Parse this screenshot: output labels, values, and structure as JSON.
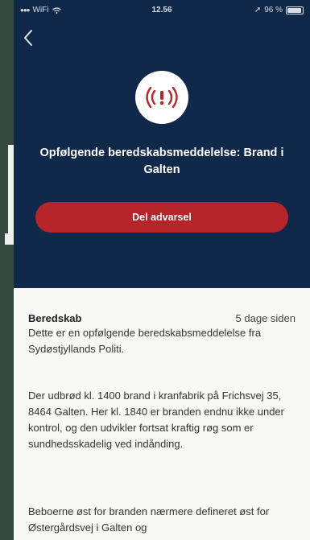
{
  "status_bar": {
    "carrier": "WiFi",
    "time": "12.56",
    "battery": "96 %",
    "battery_level": 0.96
  },
  "header": {
    "title": "Opfølgende beredskabsmeddelelse: Brand i Galten",
    "share_button": "Del advarsel",
    "accent_color": "#b5252a",
    "background_color": "#10294b"
  },
  "message": {
    "category": "Beredskab",
    "time_ago": "5 dage siden",
    "paragraphs": [
      "Dette er en opfølgende beredskabsmeddelelse fra Sydøstjyllands Politi.",
      "Der udbrød kl. 1400 brand i kranfabrik på Frichsvej 35, 8464 Galten. Her kl. 1840 er branden endnu ikke under kontrol, og den udvikler fortsat kraftig røg som er sundhedsskadelig ved indånding.",
      "Beboerne øst for branden nærmere defineret øst for Østergårdsvej i Galten og"
    ]
  },
  "icons": {
    "back": "chevron-left-icon",
    "alert": "broadcast-alert-icon"
  }
}
